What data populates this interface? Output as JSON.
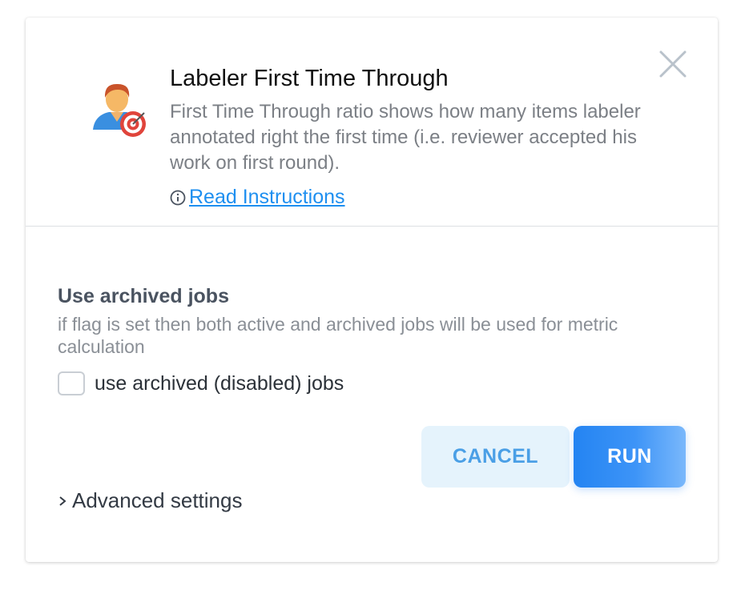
{
  "dialog": {
    "title": "Labeler First Time Through",
    "description": "First Time Through ratio shows how many items labeler annotated right the first time (i.e. reviewer accepted his work on first round).",
    "read_instructions": " Read Instructions",
    "header_icon": "user-target-icon",
    "close_icon": "close-icon"
  },
  "option": {
    "title": "Use archived jobs",
    "description": "if flag is set then both active and archived jobs will be used for metric calculation",
    "checkbox_label": "use archived (disabled) jobs",
    "checked": false
  },
  "buttons": {
    "cancel": "CANCEL",
    "run": "RUN"
  },
  "advanced": {
    "label": "Advanced settings",
    "icon": "chevron-right-icon"
  },
  "colors": {
    "link": "#1e8ff0",
    "run_button": "#2484f2",
    "cancel_bg": "#e5f3fc",
    "cancel_text": "#4a9fe6"
  }
}
